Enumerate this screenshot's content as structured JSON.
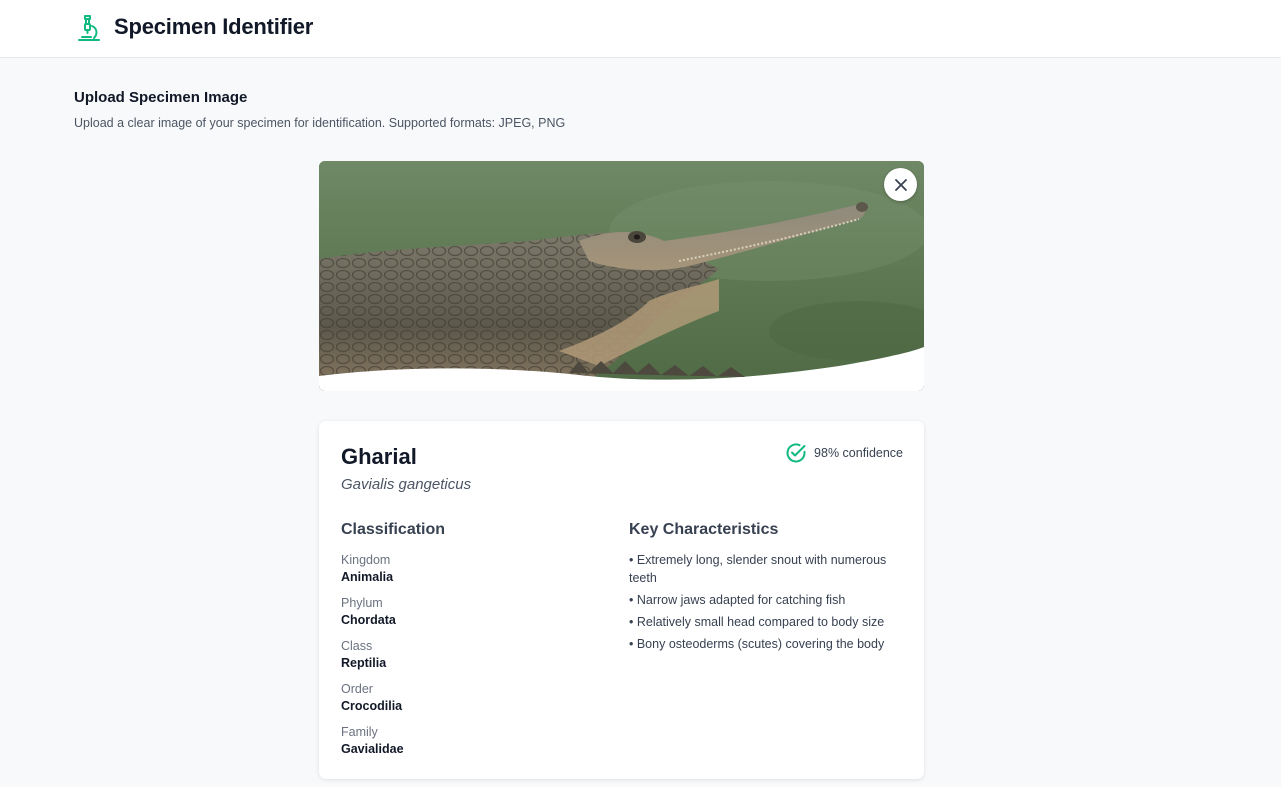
{
  "header": {
    "title": "Specimen Identifier",
    "icon": "microscope-icon",
    "accent_color": "#10b981"
  },
  "upload": {
    "title": "Upload Specimen Image",
    "description": "Upload a clear image of your specimen for identification. Supported formats: JPEG, PNG",
    "remove_icon": "close-icon"
  },
  "result": {
    "common_name": "Gharial",
    "scientific_name": "Gavialis gangeticus",
    "confidence_label": "98% confidence",
    "confidence_icon": "check-circle-icon",
    "classification_title": "Classification",
    "classification": [
      {
        "label": "Kingdom",
        "value": "Animalia"
      },
      {
        "label": "Phylum",
        "value": "Chordata"
      },
      {
        "label": "Class",
        "value": "Reptilia"
      },
      {
        "label": "Order",
        "value": "Crocodilia"
      },
      {
        "label": "Family",
        "value": "Gavialidae"
      }
    ],
    "characteristics_title": "Key Characteristics",
    "characteristics": [
      "• Extremely long, slender snout with numerous teeth",
      "• Narrow jaws adapted for catching fish",
      "• Relatively small head compared to body size",
      "• Bony osteoderms (scutes) covering the body"
    ]
  }
}
